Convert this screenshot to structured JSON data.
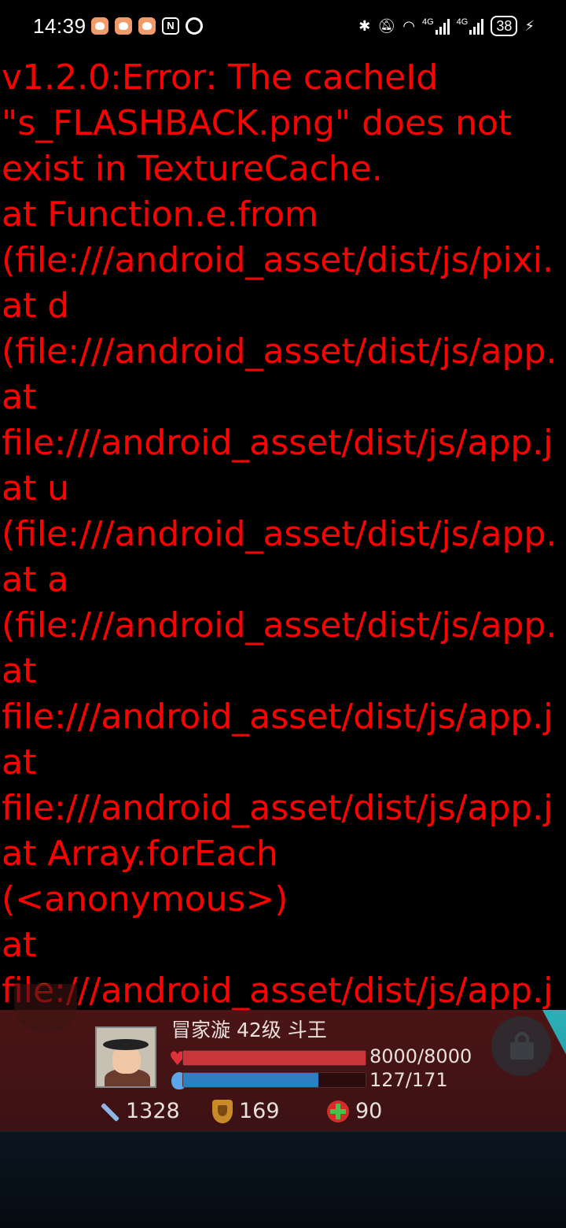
{
  "status_bar": {
    "time": "14:39",
    "nfc": "N",
    "signal1_label": "4G",
    "signal2_label": "4G",
    "battery": "38"
  },
  "error": {
    "lines": [
      "v1.2.0:Error: The cacheId",
      "\"s_FLASHBACK.png\" does not",
      "exist in TextureCache.",
      "at Function.e.from",
      "(file:///android_asset/dist/js/pixi.",
      "at d",
      "(file:///android_asset/dist/js/app.",
      "at",
      "file:///android_asset/dist/js/app.j",
      "at u",
      "(file:///android_asset/dist/js/app.",
      "at a",
      "(file:///android_asset/dist/js/app.",
      "at",
      "file:///android_asset/dist/js/app.j",
      "at",
      "file:///android_asset/dist/js/app.j",
      "at Array.forEach",
      "(<anonymous>)",
      "at",
      "file:///android_asset/dist/js/app.j"
    ],
    "color": "#ff0000"
  },
  "player": {
    "name_line": "冒家漩 42级 斗王",
    "hp_text": "8000/8000",
    "hp_fraction": 1.0,
    "mp_text": "127/171",
    "mp_fraction": 0.7427,
    "attack": "1328",
    "defense": "169",
    "heal": "90"
  }
}
